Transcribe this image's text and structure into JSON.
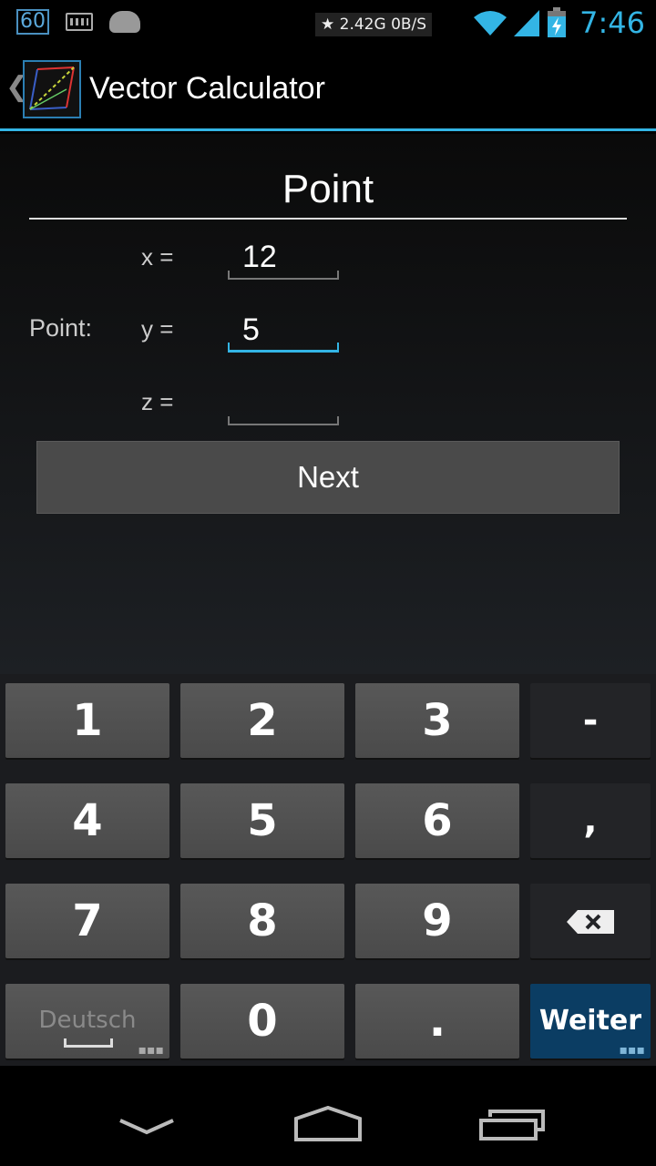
{
  "status_bar": {
    "badge": "60",
    "network": "★ 2.42G  0B/S",
    "time": "7:46",
    "icons": [
      "keyboard-icon",
      "android-icon",
      "wifi-icon",
      "signal-icon",
      "battery-charging-icon"
    ]
  },
  "action_bar": {
    "title": "Vector Calculator",
    "back_glyph": "❮",
    "icon": "vector-app-logo",
    "accent": "#33b5e5"
  },
  "form": {
    "heading": "Point",
    "row_label": "Point:",
    "fields": [
      {
        "label": "x =",
        "value": "12"
      },
      {
        "label": "y =",
        "value": "5"
      },
      {
        "label": "z =",
        "value": ""
      }
    ],
    "next_label": "Next"
  },
  "keyboard": {
    "rows": [
      [
        "1",
        "2",
        "3",
        "-"
      ],
      [
        "4",
        "5",
        "6",
        ","
      ],
      [
        "7",
        "8",
        "9",
        "⌫"
      ],
      [
        "Deutsch",
        "0",
        ".",
        "Weiter"
      ]
    ],
    "colors": {
      "key": "#4f4f4f",
      "side_key": "#232427",
      "go_key": "#0b3d63"
    }
  },
  "nav_bar": {
    "icons": [
      "back-icon",
      "home-icon",
      "recent-apps-icon"
    ]
  }
}
